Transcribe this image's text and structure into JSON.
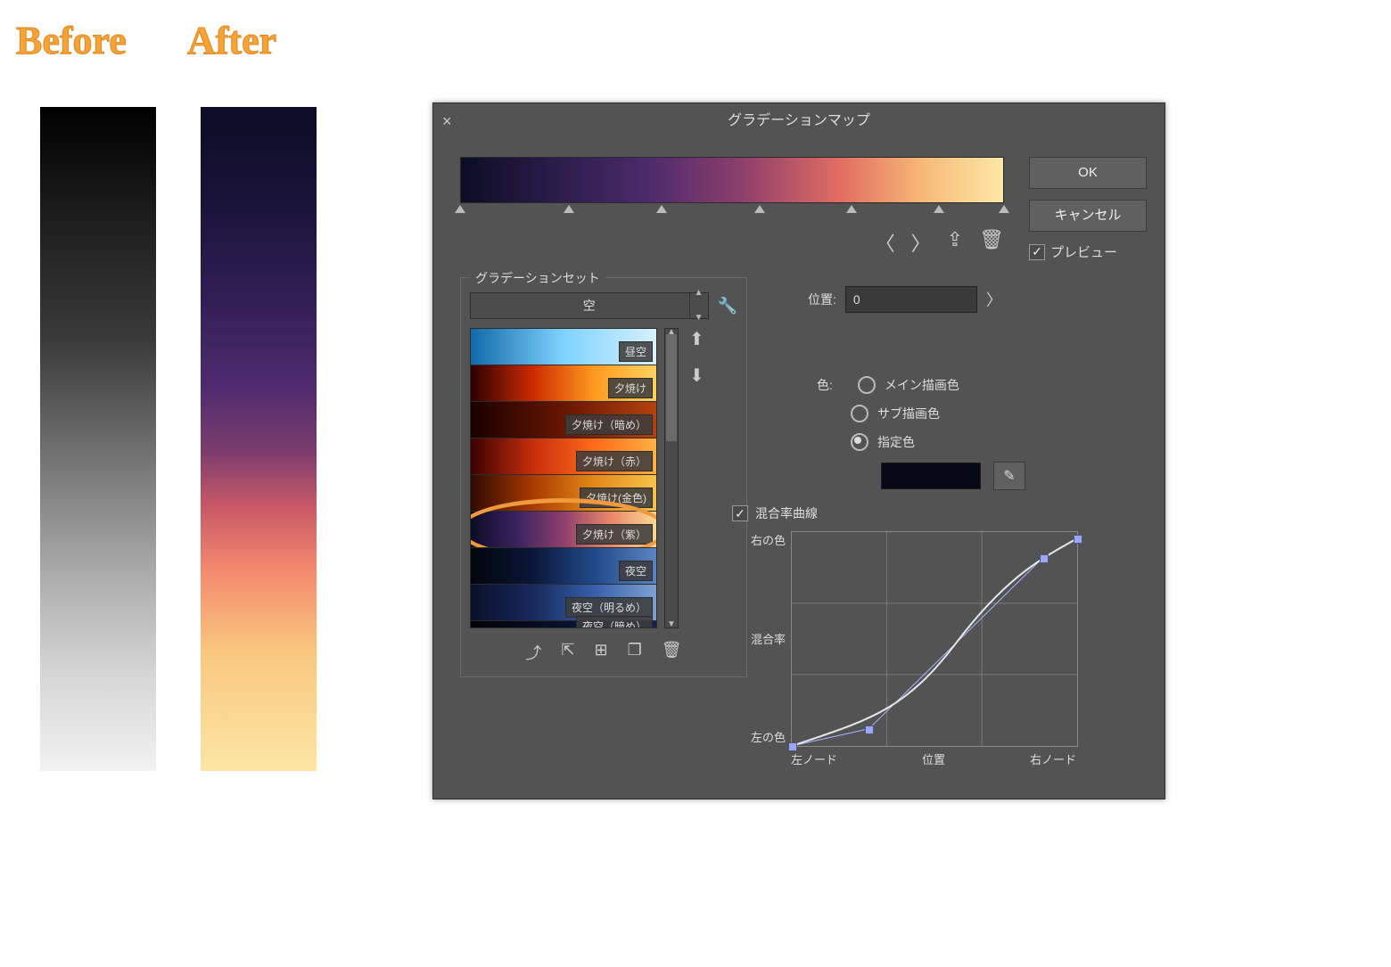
{
  "labels": {
    "before": "Before",
    "after": "After"
  },
  "dialog": {
    "title": "グラデーションマップ",
    "buttons": {
      "ok": "OK",
      "cancel": "キャンセル"
    },
    "preview_label": "プレビュー",
    "preview_checked": true,
    "gradient_stops_pct": [
      0,
      20,
      37,
      55,
      72,
      88,
      100
    ]
  },
  "gradset": {
    "legend": "グラデーションセット",
    "selected_set": "空",
    "presets": [
      {
        "cls": "g-daysky",
        "label": "昼空"
      },
      {
        "cls": "g-sunset1",
        "label": "夕焼け"
      },
      {
        "cls": "g-sunset2",
        "label": "夕焼け（暗め）"
      },
      {
        "cls": "g-sunset3",
        "label": "夕焼け（赤）"
      },
      {
        "cls": "g-sunset4",
        "label": "夕焼け(金色)"
      },
      {
        "cls": "g-sunset5",
        "label": "夕焼け（紫）"
      },
      {
        "cls": "g-night1",
        "label": "夜空"
      },
      {
        "cls": "g-night2",
        "label": "夜空（明るめ）"
      },
      {
        "cls": "g-night3",
        "label": "夜空（暗め）",
        "clipped": true
      }
    ],
    "highlighted_index": 5
  },
  "position": {
    "label": "位置:",
    "value": "0"
  },
  "color": {
    "label": "色:",
    "options": {
      "main": "メイン描画色",
      "sub": "サブ描画色",
      "fixed": "指定色"
    },
    "selected": "fixed",
    "swatch_hex": "#070814"
  },
  "curve": {
    "checkbox_label": "混合率曲線",
    "checked": true,
    "ylabels": {
      "top": "右の色",
      "mid": "混合率",
      "bottom": "左の色"
    },
    "xlabels": {
      "left": "左ノード",
      "mid": "位置",
      "right": "右ノード"
    },
    "points": [
      {
        "x": 0.0,
        "y": 0.0
      },
      {
        "x": 0.27,
        "y": 0.08
      },
      {
        "x": 0.88,
        "y": 0.88
      },
      {
        "x": 1.0,
        "y": 0.97
      }
    ]
  }
}
